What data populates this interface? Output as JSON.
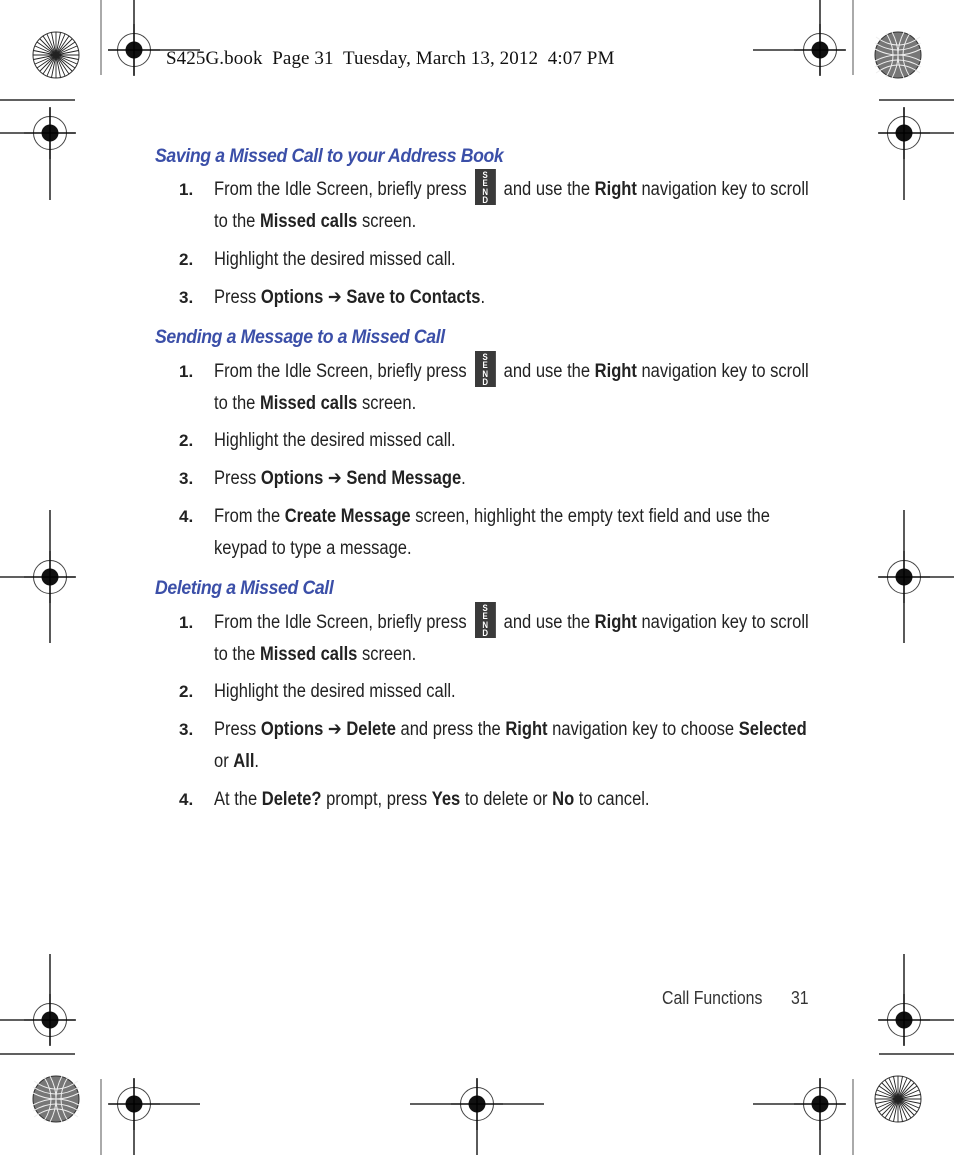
{
  "slug_line": "S425G.book  Page 31  Tuesday, March 13, 2012  4:07 PM",
  "send_key_letters": [
    "S",
    "E",
    "N",
    "D"
  ],
  "sections": [
    {
      "heading": "Saving a Missed Call to your Address Book",
      "steps": [
        {
          "num": "1.",
          "parts": [
            {
              "t": "From the Idle Screen, briefly press "
            },
            {
              "icon": "send-key"
            },
            {
              "t": " and use the "
            },
            {
              "t": "Right",
              "b": true
            },
            {
              "t": " navigation key to scroll to the "
            },
            {
              "t": "Missed calls",
              "b": true
            },
            {
              "t": " screen."
            }
          ]
        },
        {
          "num": "2.",
          "parts": [
            {
              "t": "Highlight the desired missed call."
            }
          ]
        },
        {
          "num": "3.",
          "parts": [
            {
              "t": "Press "
            },
            {
              "t": "Options ➔ Save to Contacts",
              "b": true
            },
            {
              "t": "."
            }
          ]
        }
      ]
    },
    {
      "heading": "Sending a Message to a Missed Call",
      "steps": [
        {
          "num": "1.",
          "parts": [
            {
              "t": "From the Idle Screen, briefly press "
            },
            {
              "icon": "send-key"
            },
            {
              "t": " and use the "
            },
            {
              "t": "Right",
              "b": true
            },
            {
              "t": " navigation key to scroll to the "
            },
            {
              "t": "Missed calls",
              "b": true
            },
            {
              "t": " screen."
            }
          ]
        },
        {
          "num": "2.",
          "parts": [
            {
              "t": "Highlight the desired missed call."
            }
          ]
        },
        {
          "num": "3.",
          "parts": [
            {
              "t": "Press "
            },
            {
              "t": "Options ➔ Send Message",
              "b": true
            },
            {
              "t": "."
            }
          ]
        },
        {
          "num": "4.",
          "parts": [
            {
              "t": "From the "
            },
            {
              "t": "Create Message",
              "b": true
            },
            {
              "t": " screen, highlight the empty text field and use the keypad to type a message."
            }
          ]
        }
      ]
    },
    {
      "heading": "Deleting a Missed Call",
      "steps": [
        {
          "num": "1.",
          "parts": [
            {
              "t": "From the Idle Screen, briefly press "
            },
            {
              "icon": "send-key"
            },
            {
              "t": " and use the "
            },
            {
              "t": "Right",
              "b": true
            },
            {
              "t": " navigation key to scroll to the "
            },
            {
              "t": "Missed calls",
              "b": true
            },
            {
              "t": " screen."
            }
          ]
        },
        {
          "num": "2.",
          "parts": [
            {
              "t": "Highlight the desired missed call."
            }
          ]
        },
        {
          "num": "3.",
          "parts": [
            {
              "t": "Press "
            },
            {
              "t": "Options ➔ Delete",
              "b": true
            },
            {
              "t": " and press the "
            },
            {
              "t": "Right",
              "b": true
            },
            {
              "t": " navigation key to choose "
            },
            {
              "t": "Selected",
              "b": true
            },
            {
              "t": " or "
            },
            {
              "t": "All",
              "b": true
            },
            {
              "t": "."
            }
          ]
        },
        {
          "num": "4.",
          "parts": [
            {
              "t": "At the "
            },
            {
              "t": "Delete?",
              "b": true
            },
            {
              "t": " prompt, press "
            },
            {
              "t": "Yes",
              "b": true
            },
            {
              "t": " to delete or "
            },
            {
              "t": "No",
              "b": true
            },
            {
              "t": " to cancel."
            }
          ]
        }
      ]
    }
  ],
  "footer": {
    "section_name": "Call Functions",
    "page_number": "31"
  },
  "colors": {
    "heading": "#3b4fa8",
    "body_text": "#222222",
    "send_key_bg": "#3a3a3a"
  }
}
